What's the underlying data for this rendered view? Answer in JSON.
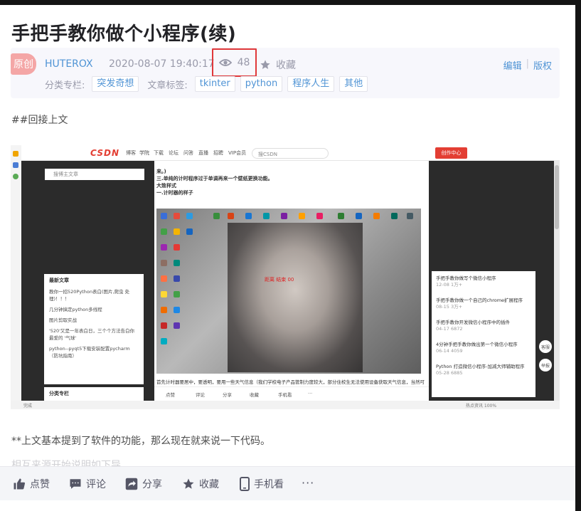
{
  "article": {
    "title": "手把手教你做个小程序(续)",
    "badge": "原创",
    "author": "HUTEROX",
    "date": "2020-08-07 19:40:17",
    "views": "48",
    "favorite_label": "收藏",
    "edit_label": "编辑",
    "copyright_label": "版权",
    "category_label": "分类专栏:",
    "categories": [
      "突发奇想"
    ],
    "tags_label": "文章标签:",
    "tags": [
      "tkinter",
      "python",
      "程序人生",
      "其他"
    ],
    "intro": "##回接上文",
    "para1": "**上文基本提到了软件的功能，那么现在就来说一下代码。",
    "partial_line": "相互来源开始说明如下导"
  },
  "screenshot": {
    "logo": "CSDN",
    "nav": [
      "博客",
      "学院",
      "下载",
      "论坛",
      "问答",
      "直播",
      "招聘",
      "VIP会员"
    ],
    "nav_search": "搜CSDN",
    "create_button": "创作中心",
    "left_search": "搜博主文章",
    "recent_title": "最新文章",
    "recent_items": [
      "教你一招520Python表白(图片,爬虫 处理)！！！",
      "几分钟搞定python多线程",
      "图片剪取实战",
      "'520'又是一年表白日，三个个方法告白你最爱的 '气球'",
      "python--pyqt5下载安装配置pycharm（防坑指南）"
    ],
    "category_title": "分类专栏",
    "center_lines": [
      "来。)",
      "三.单纯的计时程序过于单调再来一个壁纸更换功能。",
      "大致样式",
      "一.计时器的样子"
    ],
    "clock_text": "距离 结束 00",
    "center_bottom": "首先计时器要居中，要透明，要用一些天气信息（我们学校电子产品管制力度较大，部分住校生无法使用设备获取天气信息，当然可能天气信息对住校同学作用不大）",
    "actions": [
      "点赞",
      "评论",
      "分享",
      "收藏",
      "手机看"
    ],
    "right_items": [
      {
        "title": "手把手教你做写个微信小程序",
        "date": "12-08",
        "count": "1万+"
      },
      {
        "title": "手把手教你做一个自己的chrome扩展程序",
        "date": "08-15",
        "count": "3万+"
      },
      {
        "title": "手把手教你开发微信小程序中的插件",
        "date": "04-17",
        "count": "6872"
      },
      {
        "title": "4分钟手把手教你做出第一个微信小程序",
        "date": "06-14",
        "count": "4059"
      },
      {
        "title": "Python 打造微信小程序-加减大师辅助程序",
        "date": "05-28",
        "count": "6885"
      }
    ],
    "float_labels": [
      "客服",
      "举报"
    ],
    "status_left": "完成",
    "status_right": "热点资讯  100%"
  },
  "bottom_bar": {
    "like": "点赞",
    "comment": "评论",
    "share": "分享",
    "favorite": "收藏",
    "mobile": "手机看",
    "more": "···"
  },
  "colors": {
    "accent_blue": "#5094d5",
    "highlight_red": "#e0383a",
    "badge_pink": "#f4a6a6"
  }
}
